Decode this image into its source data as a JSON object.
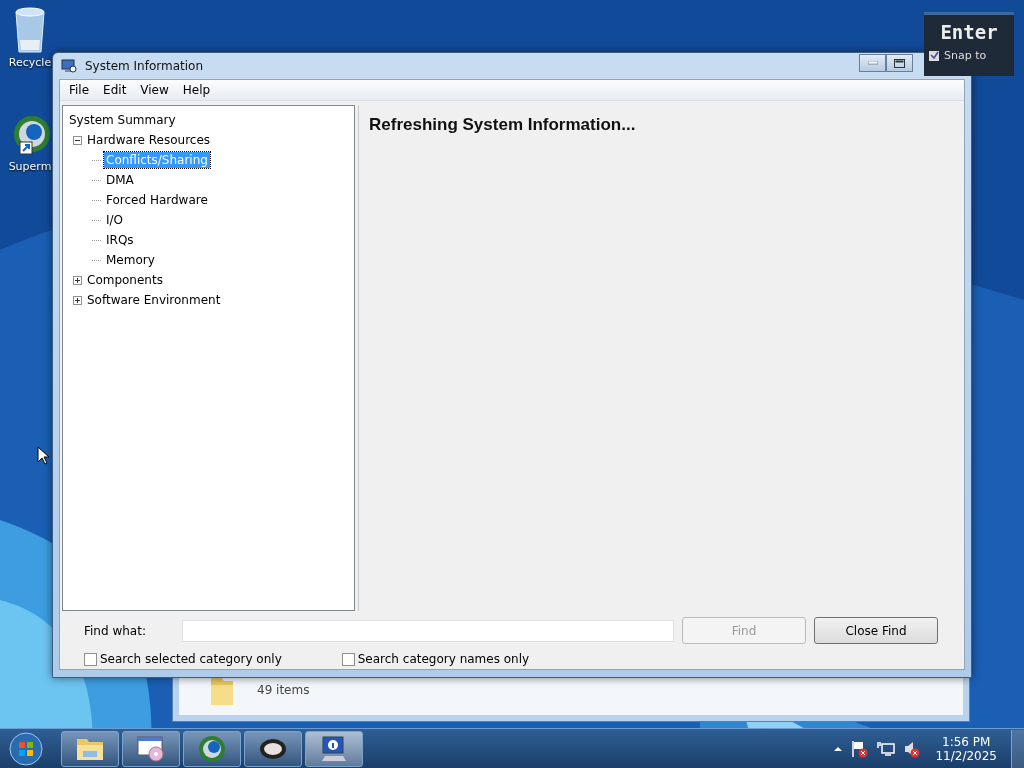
{
  "desktop_icons": [
    {
      "label": "Recycle"
    },
    {
      "label": "Superm"
    }
  ],
  "background_window": {
    "status": "49 items"
  },
  "overlay": {
    "title": "Enter",
    "snap": {
      "label": "Snap to",
      "checked": true
    }
  },
  "window": {
    "title": "System Information"
  },
  "menu": [
    "File",
    "Edit",
    "View",
    "Help"
  ],
  "tree": [
    {
      "label": "System Summary",
      "selected": false,
      "children": [
        {
          "label": "Hardware Resources",
          "selected": false,
          "expanded": true,
          "children": [
            {
              "label": "Conflicts/Sharing",
              "selected": true
            },
            {
              "label": "DMA",
              "selected": false
            },
            {
              "label": "Forced Hardware",
              "selected": false
            },
            {
              "label": "I/O",
              "selected": false
            },
            {
              "label": "IRQs",
              "selected": false
            },
            {
              "label": "Memory",
              "selected": false
            }
          ]
        },
        {
          "label": "Components",
          "selected": false,
          "expanded": false
        },
        {
          "label": "Software Environment",
          "selected": false,
          "expanded": false
        }
      ]
    }
  ],
  "content": {
    "message": "Refreshing System Information..."
  },
  "find": {
    "label": "Find what:",
    "find_button": {
      "label": "Find",
      "disabled": true
    },
    "close_button": {
      "label": "Close Find",
      "disabled": false
    },
    "options": [
      {
        "label": "Search selected category only",
        "checked": false
      },
      {
        "label": "Search category names only",
        "checked": false
      }
    ]
  },
  "taskbar": {
    "clock": {
      "time": "1:56 PM",
      "date": "11/2/2025"
    }
  }
}
